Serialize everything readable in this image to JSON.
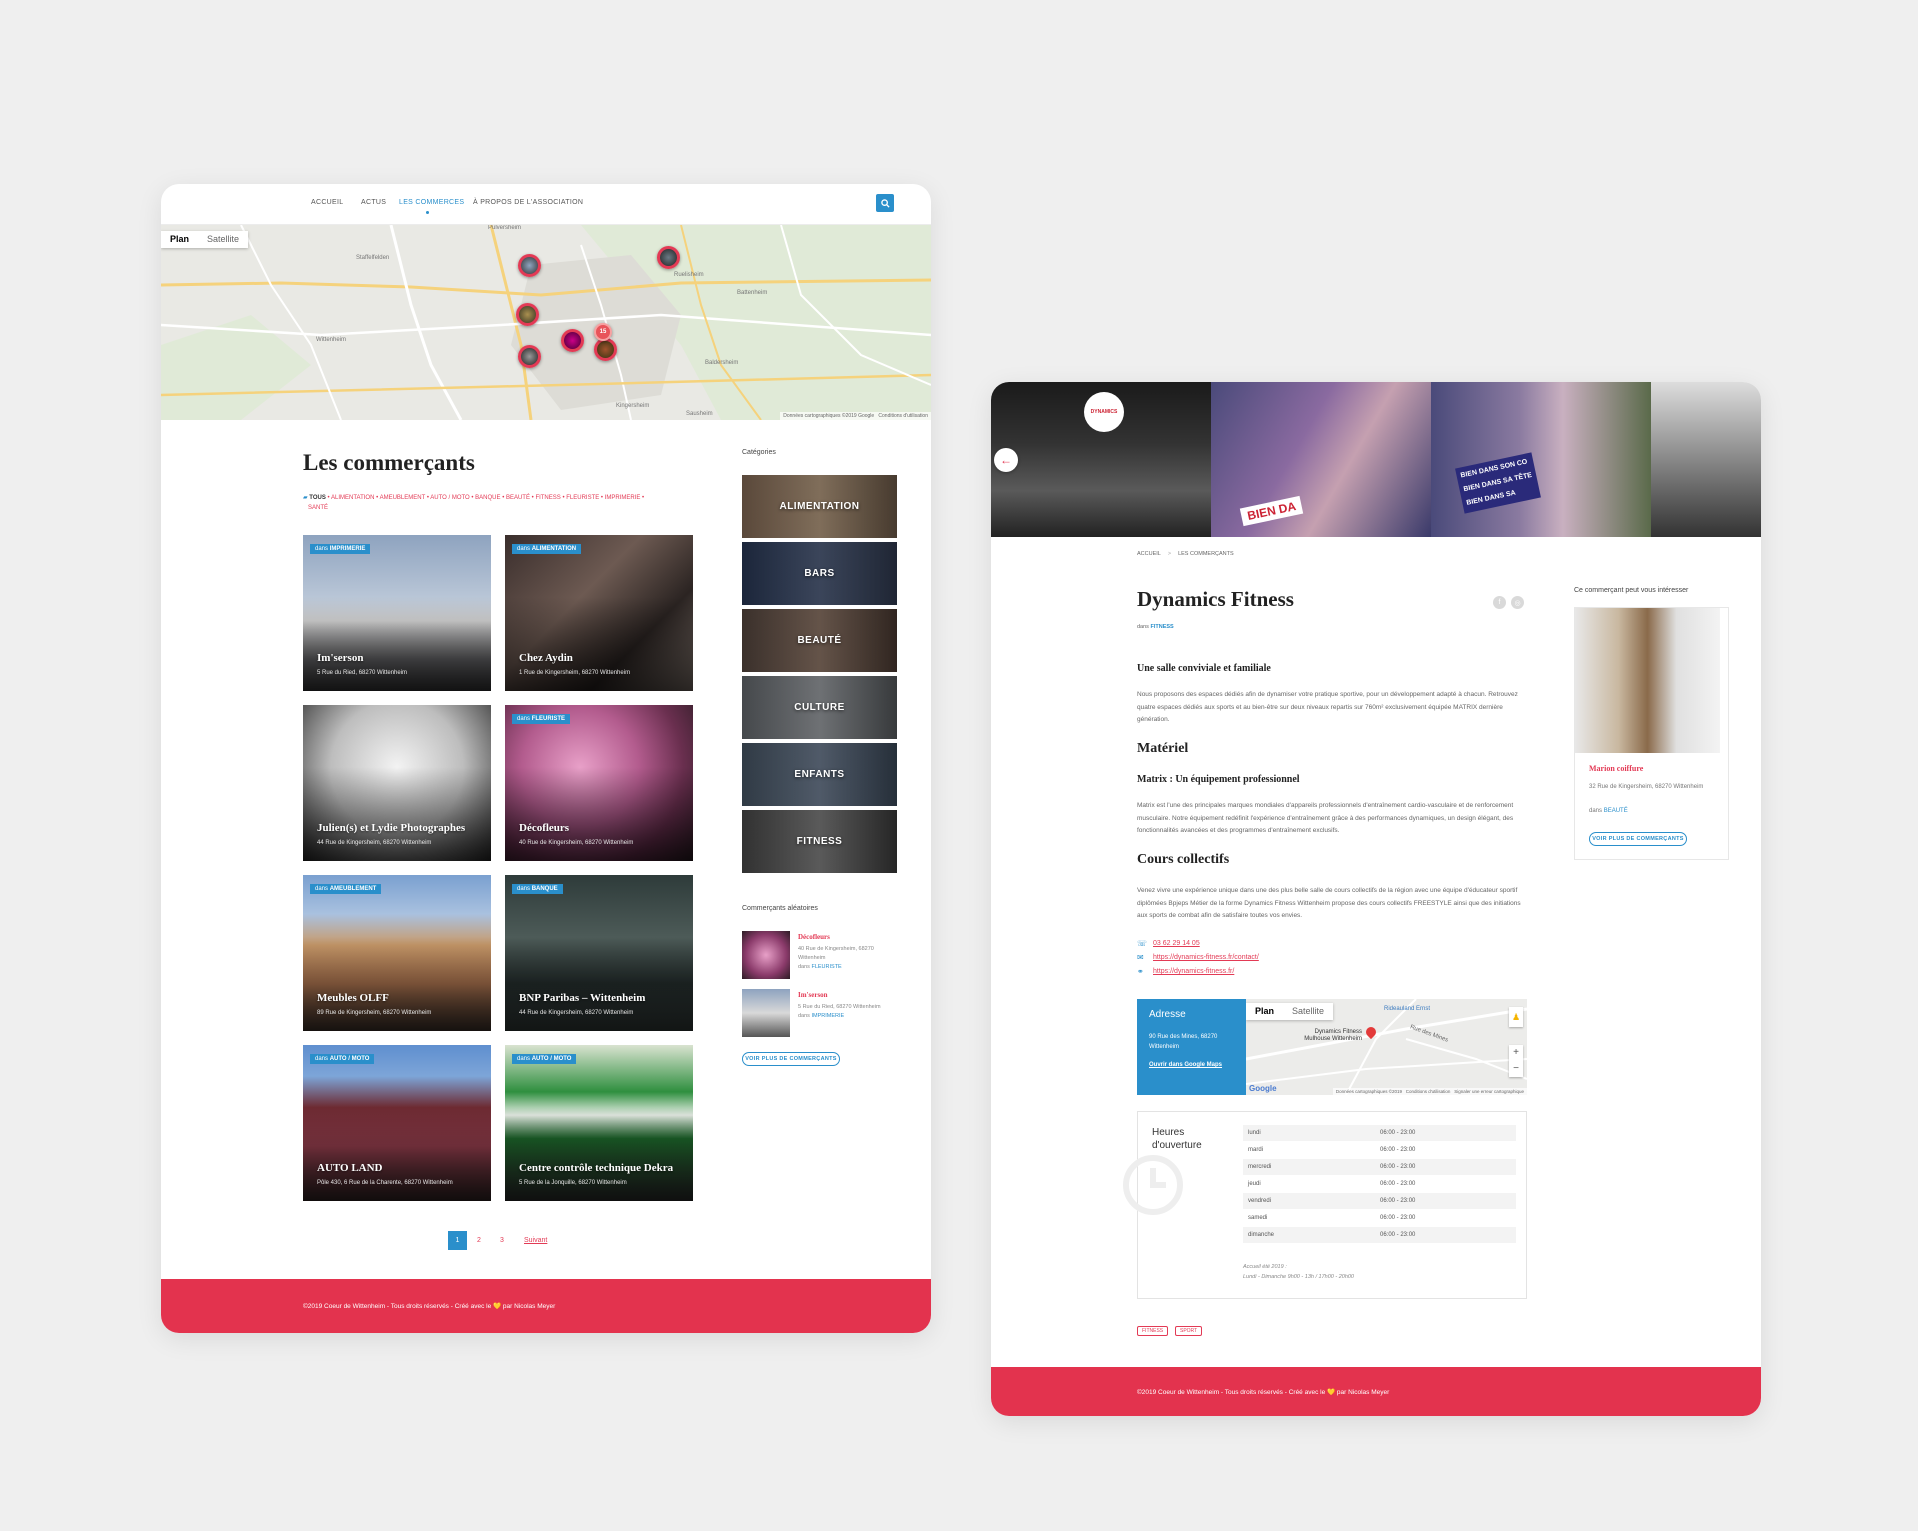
{
  "list_page": {
    "nav": {
      "home": "ACCUEIL",
      "news": "ACTUS",
      "shops": "LES COMMERCES",
      "about": "À PROPOS DE L'ASSOCIATION"
    },
    "map": {
      "plan": "Plan",
      "satellite": "Satellite",
      "credit": "Données cartographiques ©2019 Google",
      "conditions": "Conditions d'utilisation",
      "cluster": "15",
      "places": [
        "Pulversheim",
        "Staffelfelden",
        "Wittenheim",
        "Ruelisheim",
        "Battenheim",
        "Baldersheim",
        "Kingersheim",
        "Sausheim"
      ]
    },
    "title": "Les commerçants",
    "filter": {
      "all": "TOUS",
      "sep": "•",
      "items": [
        "ALIMENTATION",
        "AMEUBLEMENT",
        "AUTO / MOTO",
        "BANQUE",
        "BEAUTÉ",
        "FITNESS",
        "FLEURISTE",
        "IMPRIMERIE",
        "SANTÉ"
      ]
    },
    "badge_prefix": "dans",
    "tiles": [
      {
        "name": "Im'serson",
        "address": "5 Rue du Ried, 68270 Wittenheim",
        "category": "IMPRIMERIE"
      },
      {
        "name": "Chez Aydin",
        "address": "1 Rue de Kingersheim, 68270 Wittenheim",
        "category": "ALIMENTATION"
      },
      {
        "name": "Julien(s) et Lydie Photographes",
        "address": "44 Rue de Kingersheim, 68270 Wittenheim",
        "category": ""
      },
      {
        "name": "Décofleurs",
        "address": "40 Rue de Kingersheim, 68270 Wittenheim",
        "category": "FLEURISTE"
      },
      {
        "name": "Meubles OLFF",
        "address": "89 Rue de Kingersheim, 68270 Wittenheim",
        "category": "AMEUBLEMENT"
      },
      {
        "name": "BNP Paribas – Wittenheim",
        "address": "44 Rue de Kingersheim, 68270 Wittenheim",
        "category": "BANQUE"
      },
      {
        "name": "AUTO LAND",
        "address": "Pôle 430, 6 Rue de la Charente, 68270 Wittenheim",
        "category": "AUTO / MOTO"
      },
      {
        "name": "Centre contrôle technique Dekra",
        "address": "5 Rue de la Jonquille, 68270 Wittenheim",
        "category": "AUTO / MOTO"
      }
    ],
    "pagination": {
      "p1": "1",
      "p2": "2",
      "p3": "3",
      "next": "Suivant"
    },
    "sidebar": {
      "categories_title": "Catégories",
      "categories": [
        "ALIMENTATION",
        "BARS",
        "BEAUTÉ",
        "CULTURE",
        "ENFANTS",
        "FITNESS"
      ],
      "random_title": "Commerçants aléatoires",
      "random": [
        {
          "name": "Décofleurs",
          "address": "40 Rue de Kingersheim, 68270 Wittenheim",
          "prefix": "dans",
          "category": "FLEURISTE"
        },
        {
          "name": "Im'serson",
          "address": "5 Rue du Ried, 68270 Wittenheim",
          "prefix": "dans",
          "category": "IMPRIMERIE"
        }
      ],
      "more_button": "VOIR PLUS DE COMMERÇANTS"
    },
    "footer": "©2019 Coeur de Wittenheim - Tous droits réservés - Créé avec le 💛 par Nicolas Meyer"
  },
  "detail_page": {
    "banner_texts": [
      "DYNAMICS",
      "BIEN DA",
      "BIEN DANS SON CO",
      "BIEN DANS SA TÊTE",
      "BIEN DANS SA"
    ],
    "breadcrumb": {
      "home": "ACCUEIL",
      "sep": ">",
      "current": "LES COMMERÇANTS"
    },
    "title": "Dynamics Fitness",
    "category_prefix": "dans",
    "category": "FITNESS",
    "section1_title": "Une salle conviviale et familiale",
    "section1_text": "Nous proposons des espaces dédiés afin de dynamiser votre pratique sportive, pour un développement adapté à chacun. Retrouvez quatre espaces dédiés aux sports et au bien-être sur deux niveaux repartis sur 760m² exclusivement équipée  MATRIX dernière génération.",
    "materiel_title": "Matériel",
    "materiel_sub": "Matrix : Un équipement professionnel",
    "materiel_text": "Matrix est l'une des principales marques mondiales d'appareils professionnels d'entraînement cardio-vasculaire et de renforcement musculaire. Notre équipement redéfinit l'expérience d'entraînement grâce à des performances dynamiques, un design élégant, des fonctionnalités avancées et des programmes d'entraînement exclusifs.",
    "cours_title": "Cours collectifs",
    "cours_text": "Venez vivre une expérience unique dans une des plus belle salle de cours collectifs de la région avec une équipe d'éducateur sportif diplômées Bpjeps Métier de la forme Dynamics Fitness Wittenheim propose des cours collectifs FREESTYLE ainsi que des initiations aux sports de combat afin de satisfaire toutes vos envies.",
    "phone": "03 62 29 14 05",
    "email": "https://dynamics-fitness.fr/contact/",
    "website": "https://dynamics-fitness.fr/",
    "address_title": "Adresse",
    "address": "90 Rue des Mines, 68270 Wittenheim",
    "maps_link": "Ouvrir dans Google Maps",
    "minimap": {
      "plan": "Plan",
      "satellite": "Satellite",
      "place": "Dynamics Fitness Mulhouse Wittenheim",
      "street": "Rue des Mines",
      "poi": "Rideauland Ernst",
      "logo": "Google",
      "credit": "Données cartographiques ©2019",
      "terms": "Conditions d'utilisation",
      "report": "Signaler une erreur cartographique",
      "zoom_in": "+",
      "zoom_out": "−"
    },
    "hours_title": "Heures d'ouverture",
    "hours": [
      {
        "day": "lundi",
        "time": "06:00 - 23:00"
      },
      {
        "day": "mardi",
        "time": "06:00 - 23:00"
      },
      {
        "day": "mercredi",
        "time": "06:00 - 23:00"
      },
      {
        "day": "jeudi",
        "time": "06:00 - 23:00"
      },
      {
        "day": "vendredi",
        "time": "06:00 - 23:00"
      },
      {
        "day": "samedi",
        "time": "06:00 - 23:00"
      },
      {
        "day": "dimanche",
        "time": "06:00 - 23:00"
      }
    ],
    "hours_note1": "Accueil été 2019 :",
    "hours_note2": "Lundi - Dimanche 9h00 - 13h / 17h00 - 20h00",
    "tags": [
      "FITNESS",
      "SPORT"
    ],
    "aside": {
      "title": "Ce commerçant peut vous intéresser",
      "name": "Marion coiffure",
      "address": "32 Rue de Kingersheim, 68270 Wittenheim",
      "prefix": "dans",
      "category": "BEAUTÉ",
      "button": "VOIR PLUS DE COMMERÇANTS"
    },
    "footer": "©2019 Coeur de Wittenheim - Tous droits réservés - Créé avec le 💛 par Nicolas Meyer"
  },
  "colors": {
    "accent_blue": "#2a8fcb",
    "brand_red": "#e3334e"
  },
  "icons": [
    "search-icon",
    "folder-icon",
    "phone-icon",
    "mail-icon",
    "link-icon",
    "facebook-icon",
    "instagram-icon",
    "arrow-left-icon",
    "clock-icon",
    "map-pin-icon",
    "pegman-icon"
  ]
}
